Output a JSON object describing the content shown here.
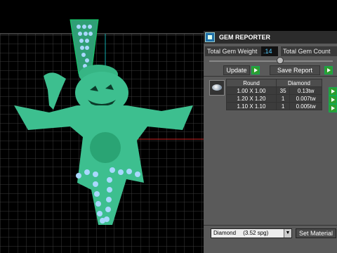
{
  "panel": {
    "title": "GEM REPORTER",
    "total_weight_label": "Total Gem Weight",
    "total_weight_value": ".14",
    "total_count_label": "Total Gem Count",
    "update_label": "Update",
    "save_label": "Save Report",
    "table": {
      "headers": [
        "Round",
        "Diamond"
      ],
      "rows": [
        {
          "size": "1.00 X 1.00",
          "count": "35",
          "weight": "0.13tw"
        },
        {
          "size": "1.20 X 1.20",
          "count": "1",
          "weight": "0.007tw"
        },
        {
          "size": "1.10 X 1.10",
          "count": "1",
          "weight": "0.005tw"
        }
      ]
    },
    "material": {
      "selected": "Diamond",
      "spec": "(3.52 spg)"
    },
    "set_material_label": "Set Material"
  },
  "colors": {
    "model": "#3dbf8f",
    "grid": "#3a3a3a",
    "stones": "#a9d8ff"
  }
}
